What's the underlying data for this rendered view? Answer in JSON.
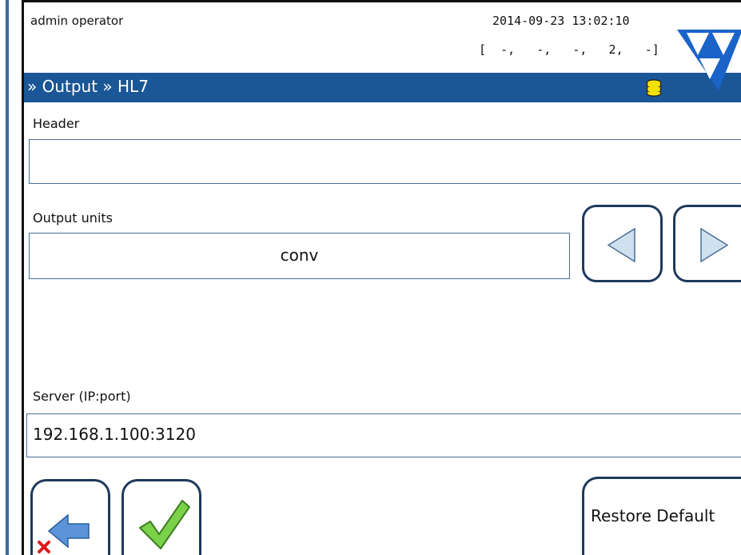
{
  "status": {
    "user": "admin operator",
    "datetime": "2014-09-23 13:02:10",
    "counters": "[  -,   -,   -,   2,   -]"
  },
  "title": {
    "breadcrumb": "» Output » HL7",
    "db_icon": "database-icon",
    "db_icon_color": "#f2e100"
  },
  "form": {
    "header_label": "Header",
    "header_value": "",
    "output_units_label": "Output units",
    "output_units_value": "conv",
    "server_label": "Server (IP:port)",
    "server_value": "192.168.1.100:3120"
  },
  "buttons": {
    "prev_icon": "triangle-left-icon",
    "next_icon": "triangle-right-icon",
    "back_icon": "back-arrow-cancel-icon",
    "ok_icon": "checkmark-icon",
    "restore_label": "Restore Default"
  },
  "colors": {
    "titlebar": "#1b5696",
    "border": "#1e3a5c",
    "logo": "#1a63c9"
  }
}
